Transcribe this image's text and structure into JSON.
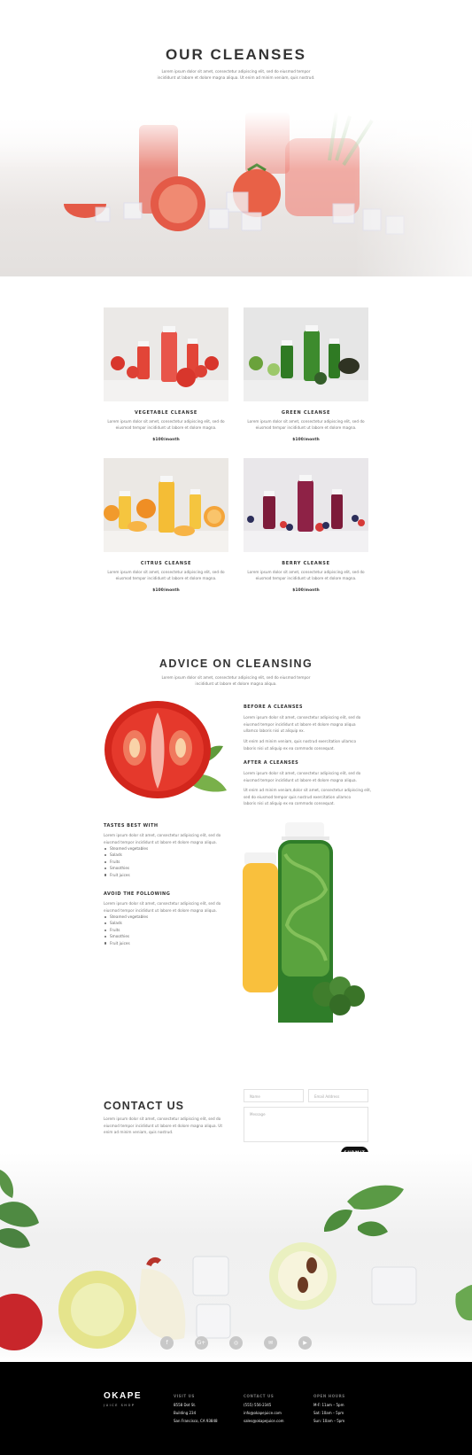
{
  "hero": {
    "title": "OUR CLEANSES",
    "desc_line1": "Lorem ipsum dolor sit amet, consectetur adipiscing elit, sed do eiusmod tempor",
    "desc_line2": "incididunt ut labore et dolore magna aliqua. Ut enim ad minim veniam, quis nostrud."
  },
  "cleanses": [
    {
      "name": "VEGETABLE CLEANSE",
      "desc1": "Lorem ipsum dolor sit amet, consectetur adipiscing elit, sed do",
      "desc2": "eiusmod tempor incididunt ut labore et dolore magna.",
      "price": "$100/month"
    },
    {
      "name": "GREEN CLEANSE",
      "desc1": "Lorem ipsum dolor sit amet, consectetur adipiscing elit, sed do",
      "desc2": "eiusmod tempor incididunt ut labore et dolore magna.",
      "price": "$100/month"
    },
    {
      "name": "CITRUS CLEANSE",
      "desc1": "Lorem ipsum dolor sit amet, consectetur adipiscing elit, sed do",
      "desc2": "eiusmod tempor incididunt ut labore et dolore magna.",
      "price": "$100/month"
    },
    {
      "name": "BERRY CLEANSE",
      "desc1": "Lorem ipsum dolor sit amet, consectetur adipiscing elit, sed do",
      "desc2": "eiusmod tempor incididunt ut labore et dolore magna.",
      "price": "$100/month"
    }
  ],
  "advice": {
    "title": "ADVICE ON CLEANSING",
    "desc_line1": "Lorem ipsum dolor sit amet, consectetur adipiscing elit, sed do eiusmod tempor",
    "desc_line2": "incididunt ut labore et dolore magna aliqua.",
    "before": {
      "heading": "BEFORE A CLEANSES",
      "p1_l1": "Lorem ipsum dolor sit amet, consectetur adipiscing elit, sed do",
      "p1_l2": "eiusmod tempor incididunt ut labore et dolore magna aliqua",
      "p1_l3": "ullamco laboris nisi ut aliquip ex.",
      "p2_l1": "Ut enim ad minim veniam, quis nostrud exercitation ullamco",
      "p2_l2": "laboris nisi ut aliquip ex ea commodo consequat."
    },
    "after": {
      "heading": "AFTER A CLEANSES",
      "p1_l1": "Lorem ipsum dolor sit amet, consectetur adipiscing elit, sed do",
      "p1_l2": "eiusmod tempor incididunt ut labore et dolore magna aliqua.",
      "p2_l1": "Ut enim ad minim veniam,dolor sit amet, consectetur adipiscing elit,",
      "p2_l2": "sed do eiusmod tempor quis nostrud exercitation ullamco",
      "p2_l3": "laboris nisi ut aliquip ex ea commodo consequat."
    },
    "tastes": {
      "heading": "TASTES BEST WITH",
      "p_l1": "Lorem ipsum dolor sit amet, consectetur adipiscing elit, sed do",
      "p_l2": "eiusmod tempor incididunt ut labore et dolore magna aliqua.",
      "items": [
        "Steamed vegetables",
        "Salads",
        "Fruits",
        "Smoothies",
        "Fruit juices"
      ]
    },
    "avoid": {
      "heading": "AVOID THE FOLLOWING",
      "p_l1": "Lorem ipsum dolor sit amet, consectetur adipiscing elit, sed do",
      "p_l2": "eiusmod tempor incididunt ut labore et dolore magna aliqua.",
      "items": [
        "Steamed vegetables",
        "Salads",
        "Fruits",
        "Smoothies",
        "Fruit juices"
      ]
    }
  },
  "contact": {
    "title": "CONTACT US",
    "p_l1": "Lorem ipsum dolor sit amet, consectetur adipiscing elit, sed do",
    "p_l2": "eiusmod tempor incididunt ut labore et dolore magna aliqua. Ut",
    "p_l3": "enim ad minim veniam, quis nostrud.",
    "name_placeholder": "Name",
    "email_placeholder": "Email Address",
    "message_placeholder": "Message",
    "submit_label": "SUBMIT"
  },
  "social": {
    "icons": [
      "facebook-icon",
      "google-plus-icon",
      "instagram-icon",
      "email-icon",
      "youtube-icon"
    ],
    "glyphs": [
      "f",
      "G+",
      "◎",
      "✉",
      "▶"
    ]
  },
  "footer": {
    "brand": "OKAPE",
    "tagline": "JUICE SHOP",
    "visit_heading": "VISIT US",
    "visit_lines": [
      "8558 Dot St.",
      "Building 234",
      "San Francisco, CA 93848"
    ],
    "contact_heading": "CONTACT US",
    "contact_lines": [
      "(555) 556-2345",
      "info@okapejuice.com",
      "sales@okapejuice.com"
    ],
    "hours_heading": "OPEN HOURS",
    "hours_lines": [
      "M-F: 11am – 5pm",
      "Sat: 10am – 5pm",
      "Sun: 10am – 5pm"
    ]
  },
  "colors": {
    "text": "#333333",
    "muted": "#777777",
    "footer_bg": "#000000",
    "button_bg": "#111111",
    "accent_red": "#d9413a",
    "accent_green": "#3f8a2c",
    "accent_orange": "#f2a93b",
    "accent_berry": "#7a1f3a"
  }
}
